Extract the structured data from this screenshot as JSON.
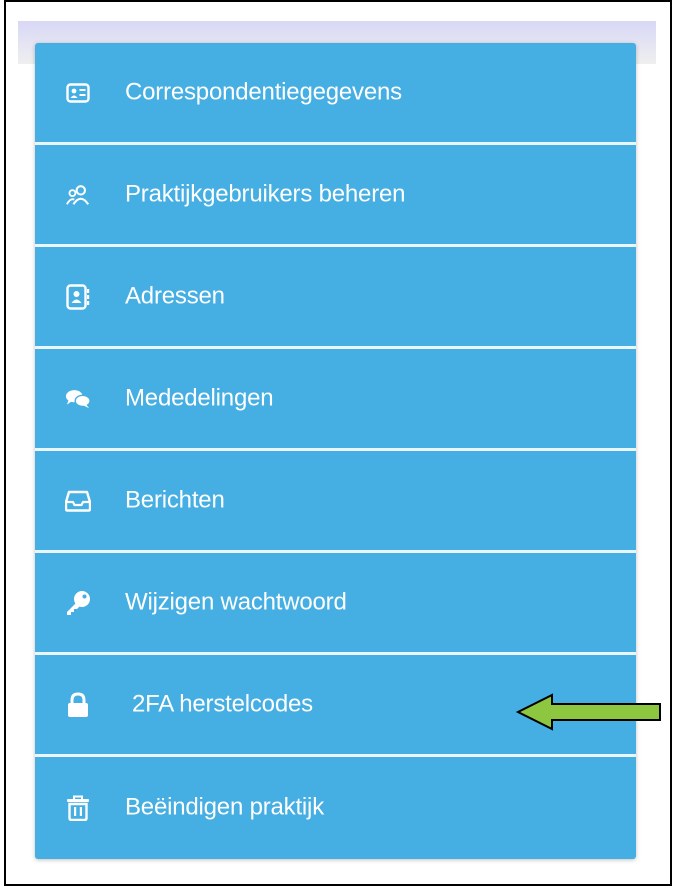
{
  "menu": {
    "items": [
      {
        "label": "Correspondentiegegevens",
        "icon": "id-card-icon"
      },
      {
        "label": "Praktijkgebruikers beheren",
        "icon": "users-icon"
      },
      {
        "label": "Adressen",
        "icon": "address-book-icon"
      },
      {
        "label": "Mededelingen",
        "icon": "comments-icon"
      },
      {
        "label": "Berichten",
        "icon": "inbox-icon"
      },
      {
        "label": "Wijzigen wachtwoord",
        "icon": "key-icon"
      },
      {
        "label": "2FA herstelcodes",
        "icon": "lock-icon"
      },
      {
        "label": "Beëindigen praktijk",
        "icon": "trash-icon"
      }
    ]
  },
  "colors": {
    "menu_background": "#45aee3",
    "separator": "#e9f6fd",
    "arrow_fill": "#8dc63f",
    "arrow_stroke": "#000000"
  }
}
